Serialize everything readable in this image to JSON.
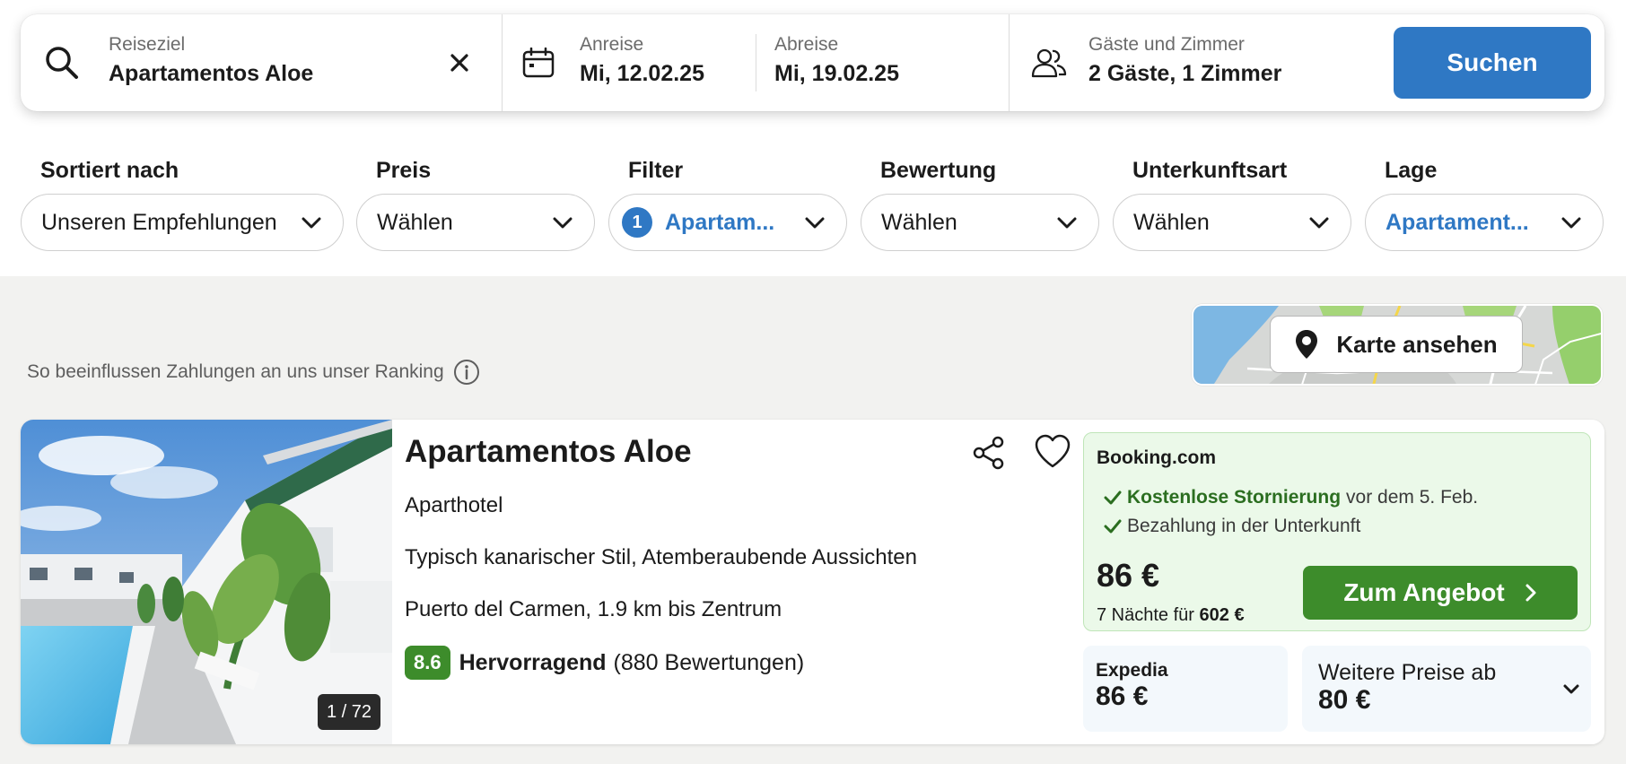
{
  "search": {
    "destination_label": "Reiseziel",
    "destination_value": "Apartamentos Aloe",
    "checkin_label": "Anreise",
    "checkin_value": "Mi, 12.02.25",
    "checkout_label": "Abreise",
    "checkout_value": "Mi, 19.02.25",
    "guests_label": "Gäste und Zimmer",
    "guests_value": "2 Gäste, 1 Zimmer",
    "search_button": "Suchen"
  },
  "filters": [
    {
      "title": "Sortiert nach",
      "value": "Unseren Empfehlungen",
      "active": false
    },
    {
      "title": "Preis",
      "value": "Wählen",
      "active": false
    },
    {
      "title": "Filter",
      "value": "Apartam...",
      "active": true,
      "count": "1"
    },
    {
      "title": "Bewertung",
      "value": "Wählen",
      "active": false
    },
    {
      "title": "Unterkunftsart",
      "value": "Wählen",
      "active": false
    },
    {
      "title": "Lage",
      "value": "Apartament...",
      "active": true
    }
  ],
  "ranking_info": "So beeinflussen Zahlungen an uns unser Ranking",
  "map": {
    "button_label": "Karte ansehen"
  },
  "hotel": {
    "photo_counter": "1 / 72",
    "name": "Apartamentos Aloe",
    "type": "Aparthotel",
    "highlights": "Typisch kanarischer Stil, Atemberaubende Aussichten",
    "location": "Puerto del Carmen, 1.9 km bis Zentrum",
    "rating_score": "8.6",
    "rating_word": "Hervorragend",
    "rating_count": "(880 Bewertungen)"
  },
  "offers": {
    "main": {
      "provider": "Booking.com",
      "perk1_strong": "Kostenlose Stornierung",
      "perk1_rest": "vor dem 5. Feb.",
      "perk2": "Bezahlung in der Unterkunft",
      "price": "86 €",
      "nights_text": "7 Nächte für",
      "total": "602 €",
      "cta": "Zum Angebot"
    },
    "secondary": {
      "provider": "Expedia",
      "price": "86 €"
    },
    "more": {
      "label": "Weitere Preise ab",
      "price": "80 €"
    }
  },
  "colors": {
    "accent_blue": "#2f78c4",
    "deal_green": "#3d8c2b",
    "deal_bg": "#ebf9e9"
  }
}
